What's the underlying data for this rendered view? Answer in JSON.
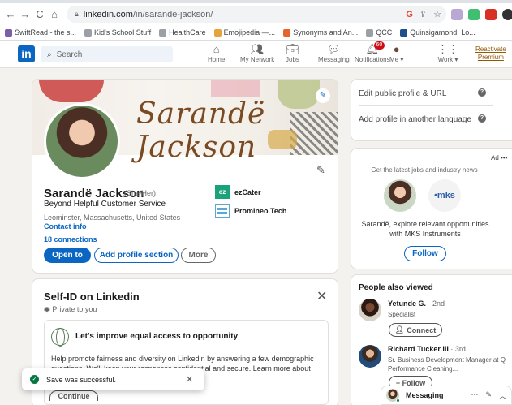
{
  "browser": {
    "url_host": "linkedin.com",
    "url_path": "/in/sarande-jackson/",
    "bookmarks": [
      {
        "label": "SwiftRead - the s...",
        "color": "#7b5ea7"
      },
      {
        "label": "Kid's School Stuff",
        "color": "#9aa0a6"
      },
      {
        "label": "HealthCare",
        "color": "#9aa0a6"
      },
      {
        "label": "Emojipedia —...",
        "color": "#e8a33d"
      },
      {
        "label": "Synonyms and An...",
        "color": "#e8622d"
      },
      {
        "label": "QCC",
        "color": "#9aa0a6"
      },
      {
        "label": "Quinsigamond: Lo...",
        "color": "#1f4e8c"
      }
    ]
  },
  "header": {
    "search_placeholder": "Search",
    "nav": [
      {
        "label": "Home",
        "icon": "home-icon"
      },
      {
        "label": "My Network",
        "icon": "network-icon"
      },
      {
        "label": "Jobs",
        "icon": "jobs-icon"
      },
      {
        "label": "Messaging",
        "icon": "messaging-icon"
      },
      {
        "label": "Notifications",
        "icon": "bell-icon",
        "badge": "60"
      },
      {
        "label": "Me ▾",
        "icon": "avatar"
      },
      {
        "label": "Work ▾",
        "icon": "grid-icon"
      }
    ],
    "reactivate_line1": "Reactivate",
    "reactivate_line2": "Premium"
  },
  "profile": {
    "banner_text": "Sarandë Jackson",
    "name": "Sarandë Jackson",
    "pronouns": "(She/Her)",
    "headline": "Beyond Helpful Customer Service",
    "location": "Leominster, Massachusetts, United States ·",
    "contact_info": "Contact info",
    "connections": "18 connections",
    "btn_open_to": "Open to",
    "btn_add_section": "Add profile section",
    "btn_more": "More",
    "companies": [
      {
        "name": "ezCater",
        "logo_text": "ez",
        "color": "#1aa37a"
      },
      {
        "name": "Promineo Tech",
        "logo_text": "",
        "color": "#5aa7d8"
      }
    ]
  },
  "selfid": {
    "title": "Self-ID on Linkedin",
    "privacy": "Private to you",
    "heading": "Let's improve equal access to opportunity",
    "body": "Help promote fairness and diversity on Linkedin by answering a few demographic questions. We'll keep your responses confidential and secure. Learn more about",
    "continue_label": "Continue"
  },
  "sidebar": {
    "edit_public": "Edit public profile & URL",
    "add_language": "Add profile in another language"
  },
  "ad": {
    "label": "Ad",
    "more": "•••",
    "subtitle": "Get the latest jobs and industry news",
    "company_logo": "•mks",
    "text": "Sarandë, explore relevant opportunities with MKS Instruments",
    "follow": "Follow"
  },
  "people_also_viewed": {
    "title": "People also viewed",
    "people": [
      {
        "name": "Yetunde G.",
        "degree": "· 2nd",
        "subtitle": "Specialist",
        "action": "Connect",
        "action_icon": "add-person-icon"
      },
      {
        "name": "Richard Tucker III",
        "degree": "· 3rd",
        "subtitle": "Sr. Business Development Manager at Q Performance Cleaning...",
        "action": "+ Follow",
        "action_icon": "plus-icon"
      }
    ]
  },
  "messaging": {
    "label": "Messaging",
    "more": "···"
  },
  "toast": {
    "message": "Save was successful.",
    "close": "✕"
  }
}
